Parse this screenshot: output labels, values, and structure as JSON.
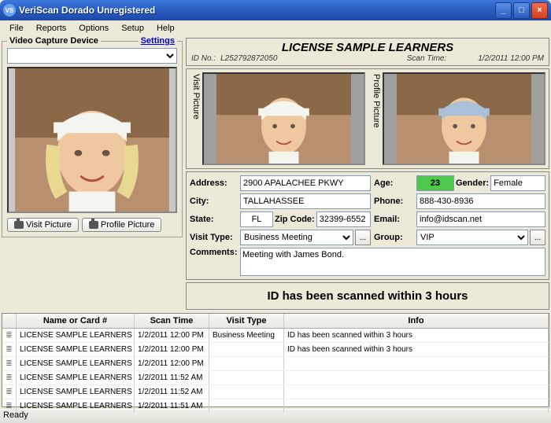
{
  "window": {
    "title": "VeriScan Dorado Unregistered"
  },
  "menu": [
    "File",
    "Reports",
    "Options",
    "Setup",
    "Help"
  ],
  "capture": {
    "group_label": "Video Capture Device",
    "settings_link": "Settings",
    "btn_visit": "Visit Picture",
    "btn_profile": "Profile Picture"
  },
  "header": {
    "name": "LICENSE SAMPLE LEARNERS",
    "idno_label": "ID No.:",
    "idno": "L252792872050",
    "scantime_label": "Scan Time:",
    "scantime": "1/2/2011 12:00 PM"
  },
  "pics": {
    "visit_label": "Visit Picture",
    "profile_label": "Profile Picture"
  },
  "form": {
    "labels": {
      "address": "Address:",
      "city": "City:",
      "state": "State:",
      "zip": "Zip Code:",
      "age": "Age:",
      "gender": "Gender:",
      "phone": "Phone:",
      "email": "Email:",
      "visit_type": "Visit Type:",
      "group": "Group:",
      "comments": "Comments:"
    },
    "address": "2900 APALACHEE PKWY",
    "city": "TALLAHASSEE",
    "state": "FL",
    "zip": "32399-6552",
    "age": "23",
    "gender": "Female",
    "phone": "888-430-8936",
    "email": "info@idscan.net",
    "visit_type": "Business Meeting",
    "group": "VIP",
    "comments": "Meeting with James Bond."
  },
  "status_msg": "ID has been scanned within 3 hours",
  "grid": {
    "headers": [
      "",
      "Name or Card #",
      "Scan Time",
      "Visit Type",
      "Info"
    ],
    "rows": [
      {
        "name": "LICENSE SAMPLE LEARNERS",
        "time": "1/2/2011 12:00 PM",
        "type": "Business Meeting",
        "info": "ID has been scanned within 3 hours"
      },
      {
        "name": "LICENSE SAMPLE LEARNERS",
        "time": "1/2/2011 12:00 PM",
        "type": "",
        "info": "ID has been scanned within 3 hours"
      },
      {
        "name": "LICENSE SAMPLE LEARNERS",
        "time": "1/2/2011 12:00 PM",
        "type": "",
        "info": ""
      },
      {
        "name": "LICENSE SAMPLE LEARNERS",
        "time": "1/2/2011 11:52 AM",
        "type": "",
        "info": ""
      },
      {
        "name": "LICENSE SAMPLE LEARNERS",
        "time": "1/2/2011 11:52 AM",
        "type": "",
        "info": ""
      },
      {
        "name": "LICENSE SAMPLE LEARNERS",
        "time": "1/2/2011 11:51 AM",
        "type": "",
        "info": ""
      }
    ]
  },
  "statusbar": "Ready"
}
